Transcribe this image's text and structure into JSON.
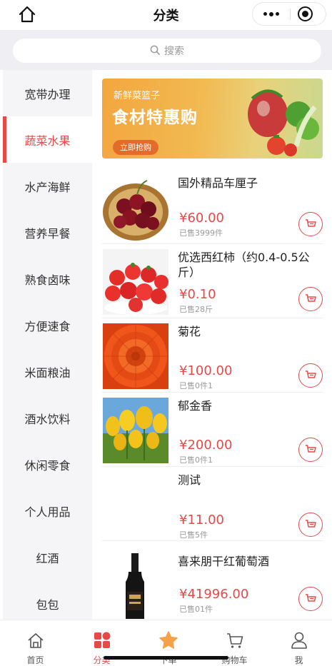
{
  "nav": {
    "title": "分类"
  },
  "search": {
    "placeholder": "搜索"
  },
  "sidebar": {
    "items": [
      {
        "label": "宽带办理"
      },
      {
        "label": "蔬菜水果",
        "active": true
      },
      {
        "label": "水产海鲜"
      },
      {
        "label": "营养早餐"
      },
      {
        "label": "熟食卤味"
      },
      {
        "label": "方便速食"
      },
      {
        "label": "米面粮油"
      },
      {
        "label": "酒水饮料"
      },
      {
        "label": "休闲零食"
      },
      {
        "label": "个人用品"
      },
      {
        "label": "红酒"
      },
      {
        "label": "包包"
      }
    ]
  },
  "banner": {
    "subtitle": "新鲜菜篮子",
    "headline": "食材特惠购",
    "cta": "立即抢购"
  },
  "products": [
    {
      "name": "国外精品车厘子",
      "price": "¥60.00",
      "sold": "已售3999件",
      "image": "cherries"
    },
    {
      "name": "优选西红柿（约0.4-0.5公斤）",
      "price": "¥0.10",
      "sold": "已售28斤",
      "image": "tomatoes"
    },
    {
      "name": "菊花",
      "price": "¥100.00",
      "sold": "已售0件1",
      "image": "chrysanthemum"
    },
    {
      "name": "郁金香",
      "price": "¥200.00",
      "sold": "已售0件1",
      "image": "tulips"
    },
    {
      "name": "测试",
      "price": "¥11.00",
      "sold": "已售5件",
      "image": ""
    },
    {
      "name": "喜来朋干红葡萄酒",
      "price": "¥41996.00",
      "sold": "已售01件",
      "image": "wine-bottle"
    }
  ],
  "tabbar": {
    "items": [
      {
        "label": "首页",
        "icon": "home-icon"
      },
      {
        "label": "分类",
        "icon": "category-icon",
        "active": true
      },
      {
        "label": "下单",
        "icon": "star-icon"
      },
      {
        "label": "购物车",
        "icon": "cart-icon"
      },
      {
        "label": "我",
        "icon": "user-icon"
      }
    ]
  },
  "colors": {
    "accent": "#e84848",
    "sidebar_bg": "#f5f5f7",
    "search_bg": "#efeff3"
  }
}
